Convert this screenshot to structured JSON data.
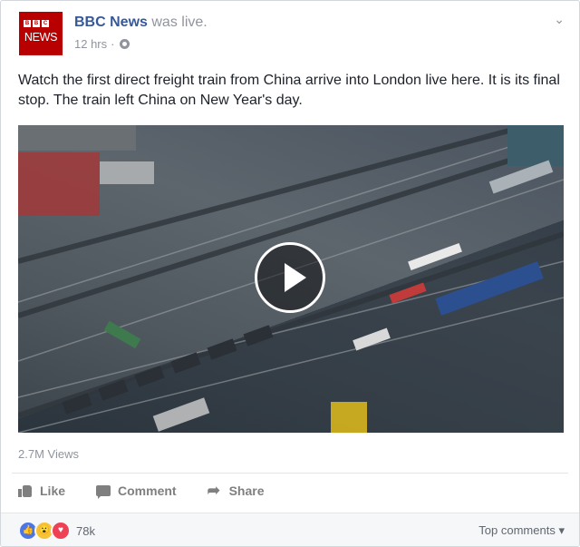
{
  "post": {
    "page_name": "BBC News",
    "action_text": "was live.",
    "timestamp": "12 hrs",
    "separator": "·",
    "logo": {
      "top": "BBC",
      "bottom": "NEWS",
      "bbc_letters": [
        "B",
        "B",
        "C"
      ],
      "color": "#b80000"
    },
    "text": "Watch the first direct freight train from China arrive into London live here. It is its final stop. The train left China on New Year's day.",
    "menu_icon": "chevron-down-icon"
  },
  "video": {
    "play_icon": "play-icon"
  },
  "stats": {
    "views": "2.7M Views"
  },
  "actions": {
    "like": "Like",
    "comment": "Comment",
    "share": "Share"
  },
  "footer": {
    "reaction_icons": [
      "like-reaction-icon",
      "wow-reaction-icon",
      "love-reaction-icon"
    ],
    "reaction_count": "78k",
    "sort_label": "Top comments",
    "sort_caret": "▾"
  },
  "colors": {
    "link": "#365899",
    "meta": "#90949c",
    "action": "#7f7f7f",
    "like": "#4a76e8",
    "love": "#ef4155",
    "wow": "#f7c234"
  }
}
